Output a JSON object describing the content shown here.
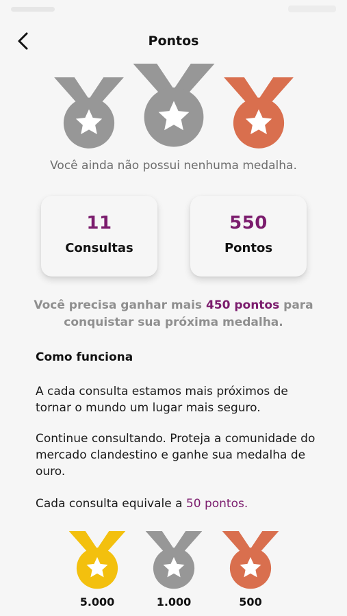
{
  "header": {
    "title": "Pontos",
    "back_icon": "chevron-left-icon"
  },
  "colors": {
    "accent": "#7b1c6d",
    "gold": "#f3c00e",
    "silver": "#979797",
    "bronze": "#d96f4e"
  },
  "top_medals": [
    {
      "icon": "star-medal-icon",
      "tier": "silver"
    },
    {
      "icon": "star-medal-icon",
      "tier": "silver"
    },
    {
      "icon": "star-medal-icon",
      "tier": "bronze"
    }
  ],
  "status": {
    "no_medal": "Você ainda não possui nenhuma medalha."
  },
  "stats": [
    {
      "value": "11",
      "label": "Consultas"
    },
    {
      "value": "550",
      "label": "Pontos"
    }
  ],
  "progress": {
    "prefix": "Você precisa ganhar mais ",
    "highlight": "450 pontos",
    "suffix": " para conquistar sua próxima medalha."
  },
  "how_it_works": {
    "title": "Como funciona",
    "p1": "A cada consulta estamos mais próximos de tornar o mundo um lugar mais seguro.",
    "p2": "Continue consultando. Proteja a comunidade do mercado clandestino e ganhe sua medalha de ouro.",
    "p3_prefix": "Cada consulta equivale a ",
    "p3_highlight": "50 pontos."
  },
  "medal_levels": [
    {
      "tier": "gold",
      "points": "5.000"
    },
    {
      "tier": "silver",
      "points": "1.000"
    },
    {
      "tier": "bronze",
      "points": "500"
    }
  ]
}
